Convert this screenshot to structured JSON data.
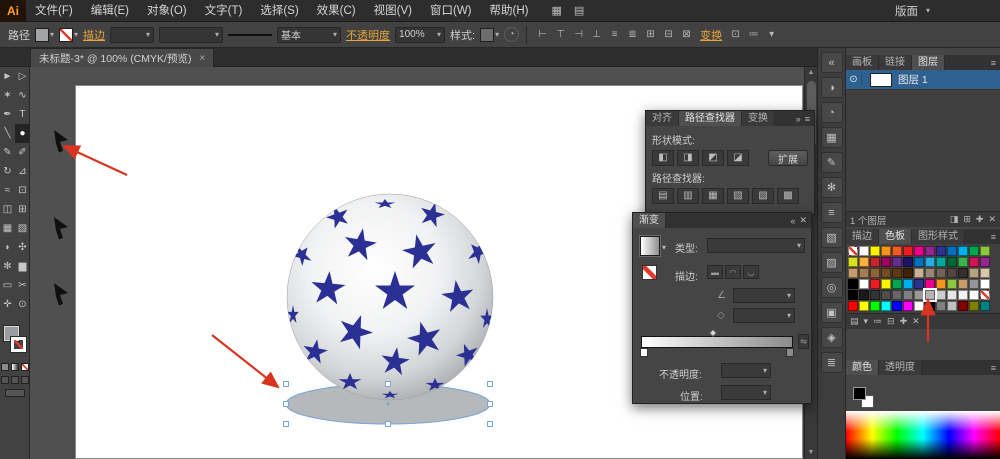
{
  "icons": {
    "dropdown": "▾",
    "menu": "≡",
    "chevrons": "»",
    "close": "✕",
    "collapse": "«",
    "eye": "⊙",
    "angle": "∠",
    "aspect": "◇",
    "reverse": "⇋",
    "up_arrow": "▲",
    "down_arrow": "▼",
    "recolor": "◔"
  },
  "menubar": {
    "logo": "Ai",
    "items": [
      "文件(F)",
      "编辑(E)",
      "对象(O)",
      "文字(T)",
      "选择(S)",
      "效果(C)",
      "视图(V)",
      "窗口(W)",
      "帮助(H)"
    ],
    "icons": [
      {
        "name": "arrange-documents-icon",
        "glyph": "▦"
      },
      {
        "name": "document-layout-icon",
        "glyph": "▤"
      }
    ],
    "workspace": "版面"
  },
  "controlbar": {
    "selection_label": "路径",
    "stroke_label": "描边",
    "brush_label": "基本",
    "opacity_label": "不透明度",
    "opacity_value": "100%",
    "style_label": "样式:",
    "transform_label": "变换",
    "icons_mid": [
      {
        "name": "align-left-icon",
        "glyph": "⊢"
      },
      {
        "name": "align-h-center-icon",
        "glyph": "⊤"
      },
      {
        "name": "align-right-icon",
        "glyph": "⊣"
      },
      {
        "name": "align-top-icon",
        "glyph": "⊥"
      },
      {
        "name": "align-v-center-icon",
        "glyph": "≡"
      },
      {
        "name": "align-bottom-icon",
        "glyph": "≣"
      },
      {
        "name": "distribute-h-icon",
        "glyph": "⊞"
      },
      {
        "name": "distribute-v-icon",
        "glyph": "⊟"
      },
      {
        "name": "align-to-selection-icon",
        "glyph": "⊠"
      }
    ],
    "icons_end": [
      {
        "name": "isolate-selected-icon",
        "glyph": "⊡"
      },
      {
        "name": "arrange-menu-icon",
        "glyph": "≔"
      },
      {
        "name": "select-similar-icon",
        "glyph": "▾"
      }
    ]
  },
  "document_tab": {
    "title": "未标题-3* @ 100% (CMYK/预览)",
    "close": "×"
  },
  "toolbar": {
    "tools": [
      {
        "name": "selection-tool",
        "glyph": "►"
      },
      {
        "name": "direct-selection-tool",
        "glyph": "▷"
      },
      {
        "name": "magic-wand-tool",
        "glyph": "✶"
      },
      {
        "name": "lasso-tool",
        "glyph": "∿"
      },
      {
        "name": "pen-tool",
        "glyph": "✒"
      },
      {
        "name": "type-tool",
        "glyph": "T"
      },
      {
        "name": "line-segment-tool",
        "glyph": "╲"
      },
      {
        "name": "ellipse-tool",
        "glyph": "●",
        "active": true
      },
      {
        "name": "paintbrush-tool",
        "glyph": "✎"
      },
      {
        "name": "pencil-tool",
        "glyph": "✐"
      },
      {
        "name": "rotate-tool",
        "glyph": "↻"
      },
      {
        "name": "scale-tool",
        "glyph": "⊿"
      },
      {
        "name": "width-tool",
        "glyph": "≈"
      },
      {
        "name": "free-transform-tool",
        "glyph": "⊡"
      },
      {
        "name": "shape-builder-tool",
        "glyph": "◫"
      },
      {
        "name": "perspective-grid-tool",
        "glyph": "⊞"
      },
      {
        "name": "mesh-tool",
        "glyph": "▦"
      },
      {
        "name": "gradient-tool",
        "glyph": "▧"
      },
      {
        "name": "eyedropper-tool",
        "glyph": "◗"
      },
      {
        "name": "blend-tool",
        "glyph": "✣"
      },
      {
        "name": "symbol-sprayer-tool",
        "glyph": "✻"
      },
      {
        "name": "column-graph-tool",
        "glyph": "▆"
      },
      {
        "name": "artboard-tool",
        "glyph": "▭"
      },
      {
        "name": "slice-tool",
        "glyph": "✂"
      },
      {
        "name": "hand-tool",
        "glyph": "✛"
      },
      {
        "name": "zoom-tool",
        "glyph": "⊙"
      }
    ]
  },
  "right_dock": {
    "strip": [
      {
        "name": "collapse-panels-icon",
        "glyph": "«"
      },
      {
        "name": "color-panel-icon",
        "glyph": "◑"
      },
      {
        "name": "color-guide-panel-icon",
        "glyph": "◔"
      },
      {
        "name": "swatches-panel-icon",
        "glyph": "▦"
      },
      {
        "name": "brushes-panel-icon",
        "glyph": "✎"
      },
      {
        "name": "symbols-panel-icon",
        "glyph": "✻"
      },
      {
        "name": "stroke-panel-icon",
        "glyph": "≡"
      },
      {
        "name": "gradient-panel-icon",
        "glyph": "▧"
      },
      {
        "name": "transparency-panel-icon",
        "glyph": "▨"
      },
      {
        "name": "appearance-panel-icon",
        "glyph": "◎"
      },
      {
        "name": "graphic-styles-panel-icon",
        "glyph": "▣"
      },
      {
        "name": "links-panel-icon",
        "glyph": "◈"
      },
      {
        "name": "align-panel-icon",
        "glyph": "≣"
      }
    ]
  },
  "panels": {
    "pathfinder": {
      "tabs": [
        {
          "label": "对齐",
          "name": "tab-align"
        },
        {
          "label": "路径查找器",
          "name": "tab-pathfinder",
          "active": true
        },
        {
          "label": "变换",
          "name": "tab-transform"
        }
      ],
      "shape_mode_label": "形状模式:",
      "expand_button": "扩展",
      "pathfinder_label": "路径查找器:",
      "shape_modes": [
        {
          "name": "unite-button",
          "glyph": "◧"
        },
        {
          "name": "minus-front-button",
          "glyph": "◨"
        },
        {
          "name": "intersect-button",
          "glyph": "◩"
        },
        {
          "name": "exclude-button",
          "glyph": "◪"
        }
      ],
      "ops": [
        {
          "name": "divide-button",
          "glyph": "▤"
        },
        {
          "name": "trim-button",
          "glyph": "▥"
        },
        {
          "name": "merge-button",
          "glyph": "▦"
        },
        {
          "name": "crop-button",
          "glyph": "▧"
        },
        {
          "name": "outline-button",
          "glyph": "▨"
        },
        {
          "name": "minus-back-button",
          "glyph": "▩"
        }
      ]
    },
    "gradient": {
      "tab": "渐变",
      "type_label": "类型:",
      "stroke_label": "描边:",
      "opacity_label": "不透明度:",
      "position_label": "位置:",
      "stroke_buttons": [
        {
          "name": "gradient-within-stroke-button",
          "glyph": "▬"
        },
        {
          "name": "gradient-along-stroke-button",
          "glyph": "◠"
        },
        {
          "name": "gradient-across-stroke-button",
          "glyph": "◡"
        }
      ]
    },
    "layers": {
      "tabs": [
        {
          "label": "画板",
          "name": "tab-artboards"
        },
        {
          "label": "链接",
          "name": "tab-links"
        },
        {
          "label": "图层",
          "name": "tab-layers",
          "active": true
        }
      ],
      "layer_name": "图层 1",
      "status": "1 个图层",
      "footer_icons": [
        {
          "name": "make-clipping-mask-icon",
          "glyph": "◨"
        },
        {
          "name": "new-sublayer-icon",
          "glyph": "⊞"
        },
        {
          "name": "new-layer-icon",
          "glyph": "✚"
        },
        {
          "name": "delete-layer-icon",
          "glyph": "✕"
        }
      ]
    },
    "swatches": {
      "tabs": [
        {
          "label": "描边",
          "name": "tab-stroke"
        },
        {
          "label": "色板",
          "name": "tab-swatches",
          "active": true
        },
        {
          "label": "图形样式",
          "name": "tab-graphic-styles"
        }
      ],
      "selected": [
        4,
        7
      ],
      "rows": [
        [
          "none",
          "#ffffff",
          "#fff200",
          "#f7941d",
          "#f15a24",
          "#ed1c24",
          "#ec008c",
          "#92278f",
          "#2e3192",
          "#0072bc",
          "#00aeef",
          "#00a651",
          "#8dc63f"
        ],
        [
          "#d9e021",
          "#fbb03b",
          "#c1272d",
          "#9e005d",
          "#662d91",
          "#1b1464",
          "#0071bc",
          "#29abe2",
          "#00a99d",
          "#006837",
          "#39b54a",
          "#d4145a",
          "#93278f"
        ],
        [
          "#c69c6d",
          "#a67c52",
          "#8c6239",
          "#754c24",
          "#603913",
          "#42210b",
          "#c7b299",
          "#998675",
          "#736357",
          "#534741",
          "#362f2d",
          "#b3a580",
          "#d9c7a9"
        ],
        [
          "#000000",
          "#ffffff",
          "#ed1c24",
          "#fff200",
          "#00a651",
          "#00aeef",
          "#2e3192",
          "#ec008c",
          "#f7941d",
          "#8dc63f",
          "#c69c6d",
          "#939598",
          "#ffffff"
        ],
        [
          "#000000",
          "#1a1a1a",
          "#333333",
          "#4d4d4d",
          "#666666",
          "#808080",
          "#999999",
          "#b3b3b3",
          "#cccccc",
          "#e6e6e6",
          "#f2f2f2",
          "#ffffff",
          "none"
        ],
        [
          "#ff0000",
          "#ffff00",
          "#00ff00",
          "#00ffff",
          "#0000ff",
          "#ff00ff",
          "#ffffff",
          "#000000",
          "#808080",
          "#c0c0c0",
          "#800000",
          "#808000",
          "#008080"
        ]
      ],
      "footer_icons": [
        {
          "name": "swatch-libraries-icon",
          "glyph": "▤"
        },
        {
          "name": "swatch-kinds-icon",
          "glyph": "▾"
        },
        {
          "name": "swatch-options-icon",
          "glyph": "≔"
        },
        {
          "name": "new-color-group-icon",
          "glyph": "⊟"
        },
        {
          "name": "new-swatch-icon",
          "glyph": "✚"
        },
        {
          "name": "delete-swatch-icon",
          "glyph": "✕"
        }
      ]
    },
    "color": {
      "tabs": [
        {
          "label": "颜色",
          "name": "tab-color",
          "active": true
        },
        {
          "label": "透明度",
          "name": "tab-transparency"
        }
      ]
    }
  }
}
